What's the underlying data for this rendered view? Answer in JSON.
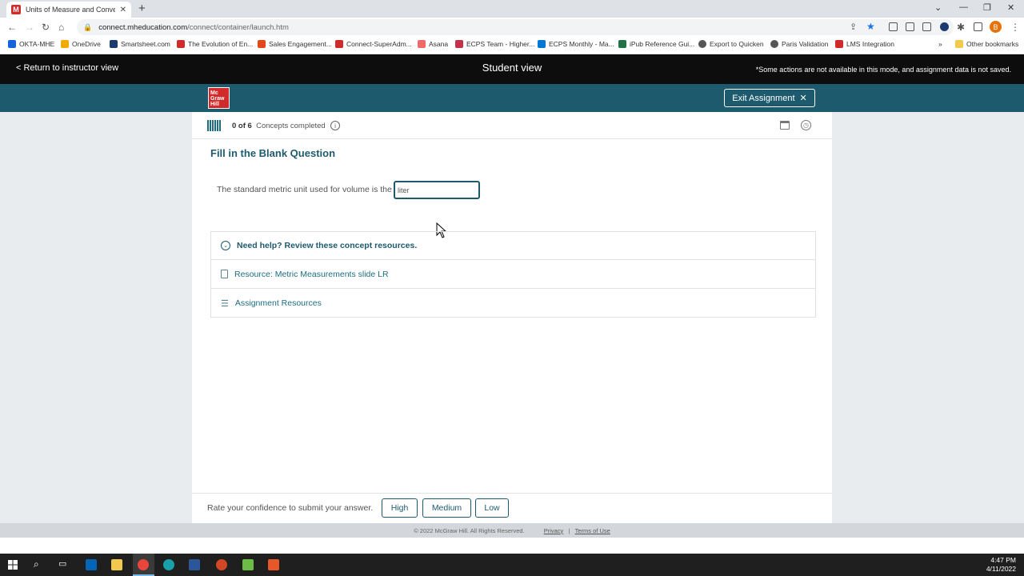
{
  "browser": {
    "tab_title": "Units of Measure and Conversion",
    "tab_favicon": "M",
    "url_host": "connect.mheducation.com",
    "url_path": "/connect/container/launch.htm",
    "profile_initial": "B",
    "bookmarks": [
      {
        "label": "OKTA-MHE",
        "color": "#1662dd"
      },
      {
        "label": "OneDrive",
        "color": "#f2a900"
      },
      {
        "label": "Smartsheet.com",
        "color": "#1b3b70"
      },
      {
        "label": "The Evolution of En...",
        "color": "#d12a2a"
      },
      {
        "label": "Sales Engagement...",
        "color": "#e04a1a"
      },
      {
        "label": "Connect-SuperAdm...",
        "color": "#d12a2a"
      },
      {
        "label": "Asana",
        "color": "#f06a6a"
      },
      {
        "label": "ECPS Team - Higher...",
        "color": "#c4314b"
      },
      {
        "label": "ECPS Monthly - Ma...",
        "color": "#0078d4"
      },
      {
        "label": "iPub Reference Gui...",
        "color": "#217346"
      },
      {
        "label": "Export to Quicken",
        "color": "#555555"
      },
      {
        "label": "Paris Validation",
        "color": "#555555"
      },
      {
        "label": "LMS Integration",
        "color": "#d12a2a"
      }
    ],
    "more_bookmarks": "»",
    "other_bookmarks": "Other bookmarks"
  },
  "studentbar": {
    "return_label": "< Return to instructor view",
    "title": "Student view",
    "notice": "*Some actions are not available in this mode, and assignment data is not saved."
  },
  "brand": {
    "logo_lines": [
      "Mc",
      "Graw",
      "Hill"
    ],
    "exit_label": "Exit Assignment",
    "exit_icon": "✕"
  },
  "progress": {
    "count": "0 of 6",
    "label": "Concepts completed",
    "info_icon": "i"
  },
  "question": {
    "title": "Fill in the Blank Question",
    "prompt": "The standard metric unit used for volume is the",
    "answer": "liter"
  },
  "help": {
    "title": "Need help? Review these concept resources.",
    "resource": "Resource: Metric Measurements slide LR",
    "assignment_resources": "Assignment Resources"
  },
  "confidence": {
    "prompt": "Rate your confidence to submit your answer.",
    "high": "High",
    "medium": "Medium",
    "low": "Low"
  },
  "footer": {
    "copyright": "© 2022 McGraw Hill. All Rights Reserved.",
    "privacy": "Privacy",
    "separator": "|",
    "terms": "Terms of Use"
  },
  "taskbar": {
    "time": "4:47 PM",
    "date": "4/11/2022"
  }
}
